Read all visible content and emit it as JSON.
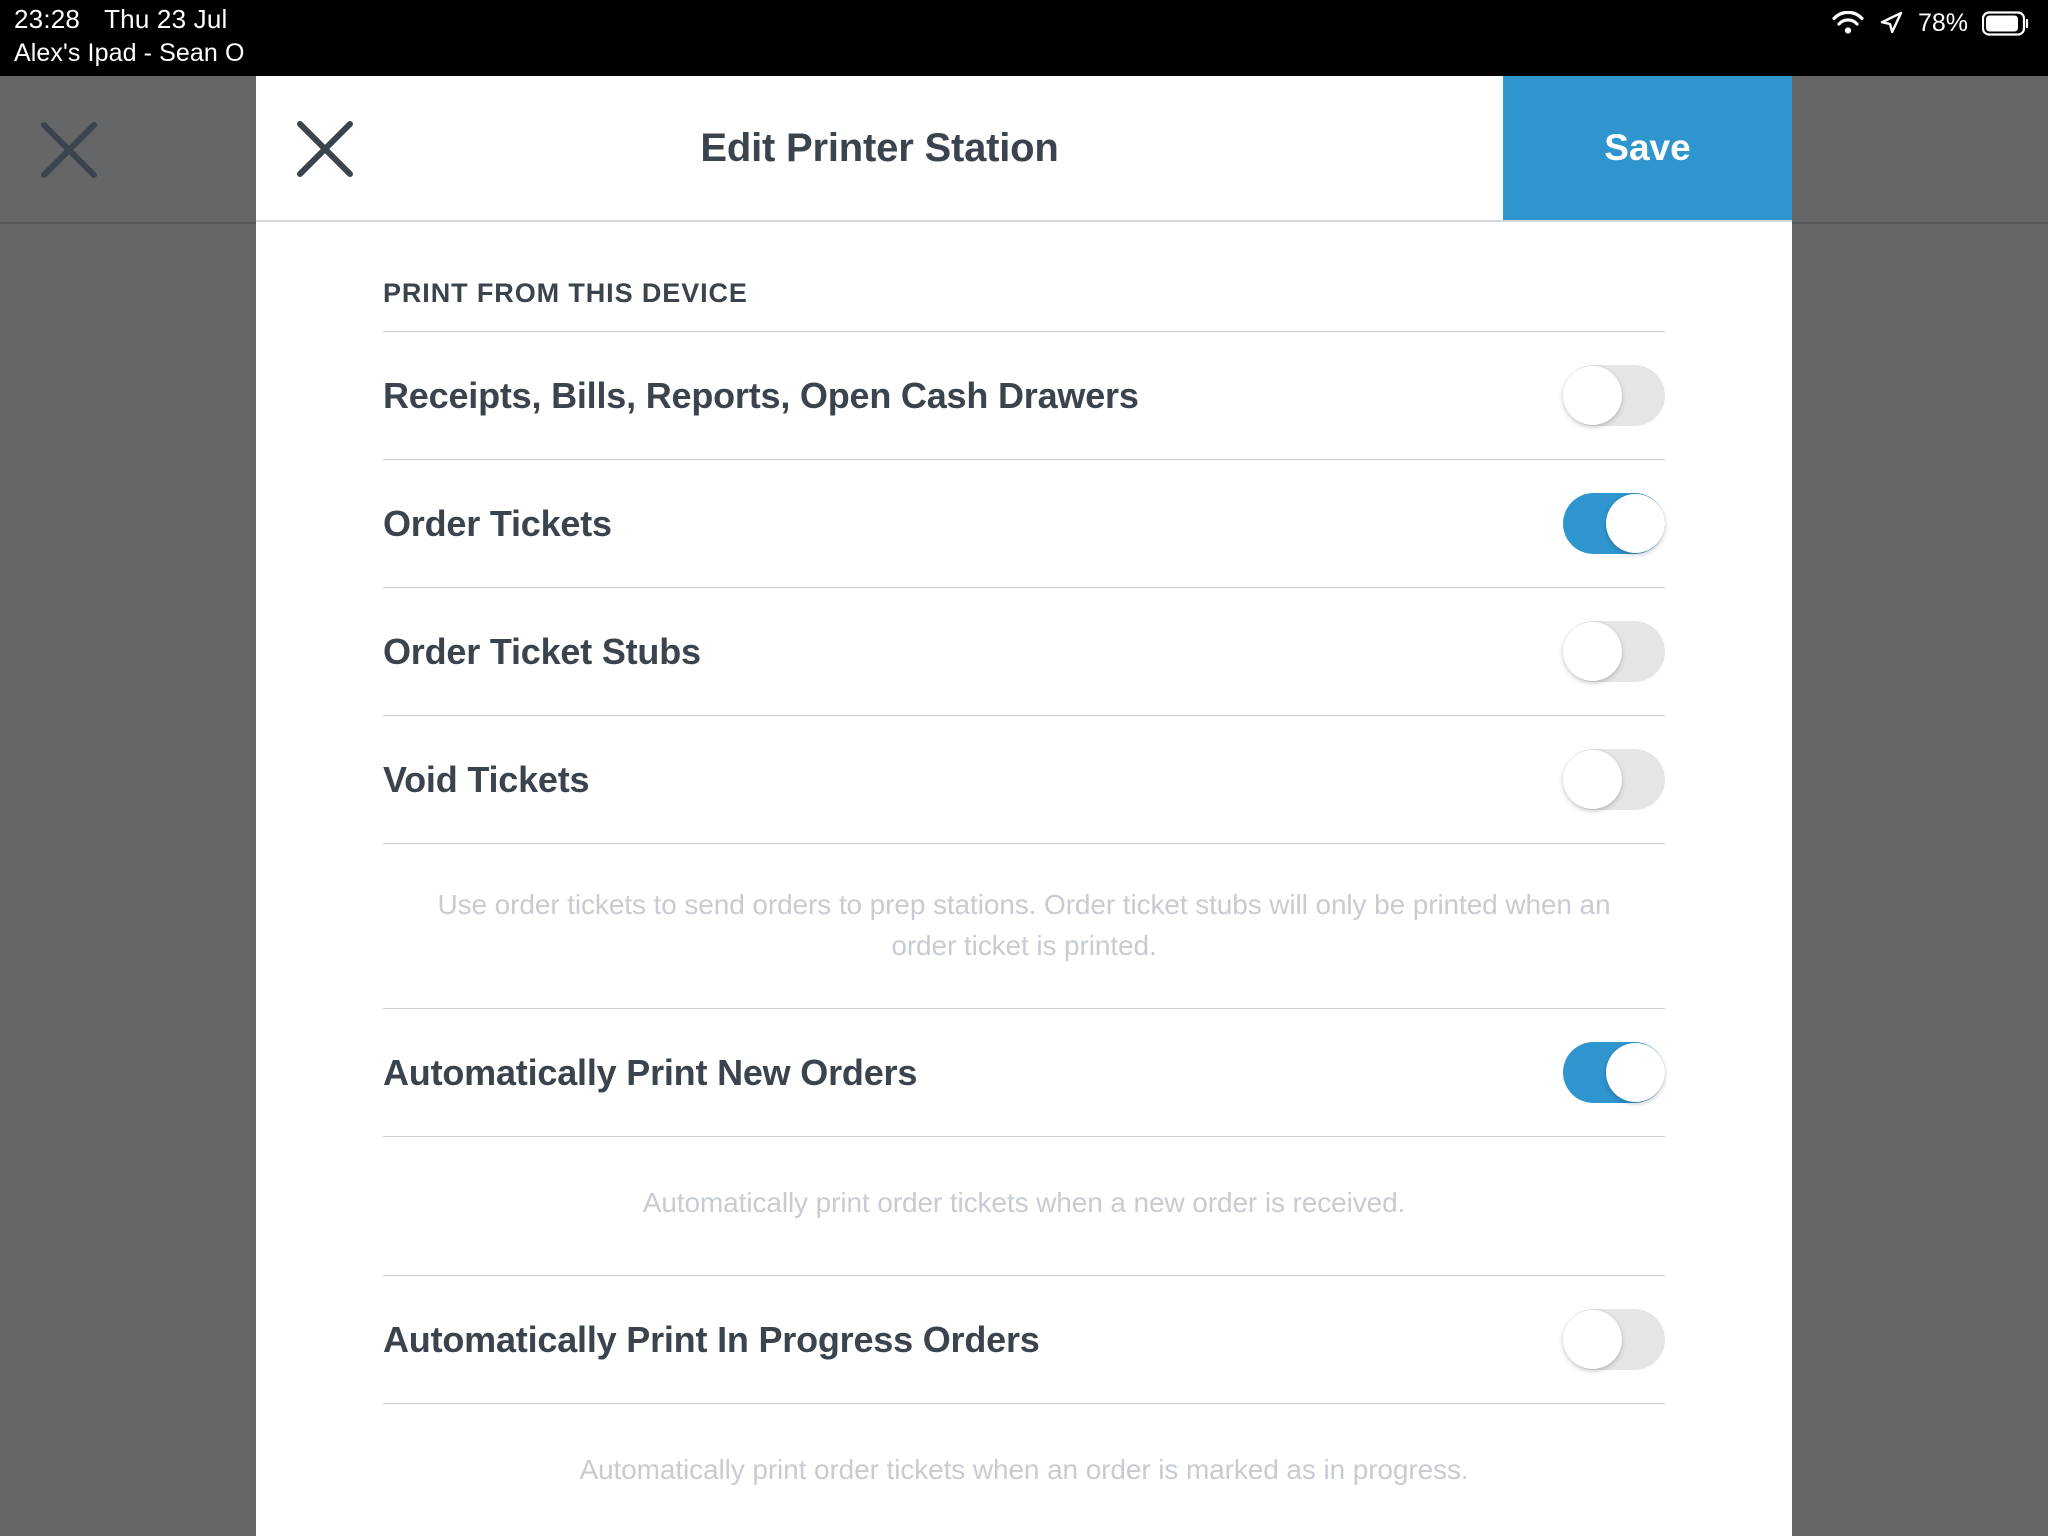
{
  "status_bar": {
    "time": "23:28",
    "date": "Thu 23 Jul",
    "device_line": "Alex's Ipad - Sean O",
    "battery_percent": "78%",
    "icons": [
      "wifi-icon",
      "location-arrow-icon",
      "battery-icon"
    ]
  },
  "backdrop": {
    "close_icon": "close-icon"
  },
  "modal": {
    "title": "Edit Printer Station",
    "close_icon": "close-icon",
    "save_label": "Save",
    "accent_color": "#2f95ce",
    "text_color": "#3b444d",
    "help_text_color": "#c7ccd2"
  },
  "content": {
    "section_header": "PRINT FROM THIS DEVICE",
    "settings": [
      {
        "label": "Receipts, Bills, Reports, Open Cash Drawers",
        "state": "off"
      },
      {
        "label": "Order Tickets",
        "state": "on"
      },
      {
        "label": "Order Ticket Stubs",
        "state": "off"
      },
      {
        "label": "Void Tickets",
        "state": "off"
      }
    ],
    "help_tickets": "Use order tickets to send orders to prep stations. Order ticket stubs will only be printed when an order ticket is printed.",
    "auto_new_orders": {
      "label": "Automatically Print New Orders",
      "state": "on"
    },
    "help_new_orders": "Automatically print order tickets when a new order is received.",
    "auto_in_progress": {
      "label": "Automatically Print In Progress Orders",
      "state": "off"
    },
    "help_in_progress": "Automatically print order tickets when an order is marked as in progress."
  }
}
